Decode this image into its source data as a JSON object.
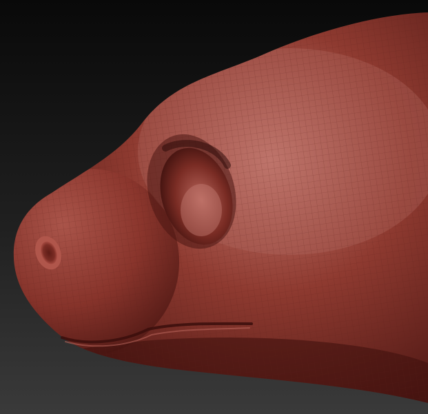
{
  "viewport": {
    "subject": "sculpted-creature-head",
    "colors": {
      "background_top": "#090909",
      "background_bottom": "#3a3a3a",
      "clay_base": "#8e3a30",
      "clay_highlight": "#c57a70",
      "clay_shadow": "#4a1512",
      "cavity": "#3a0e0c",
      "wire": "#5a1f19"
    }
  }
}
